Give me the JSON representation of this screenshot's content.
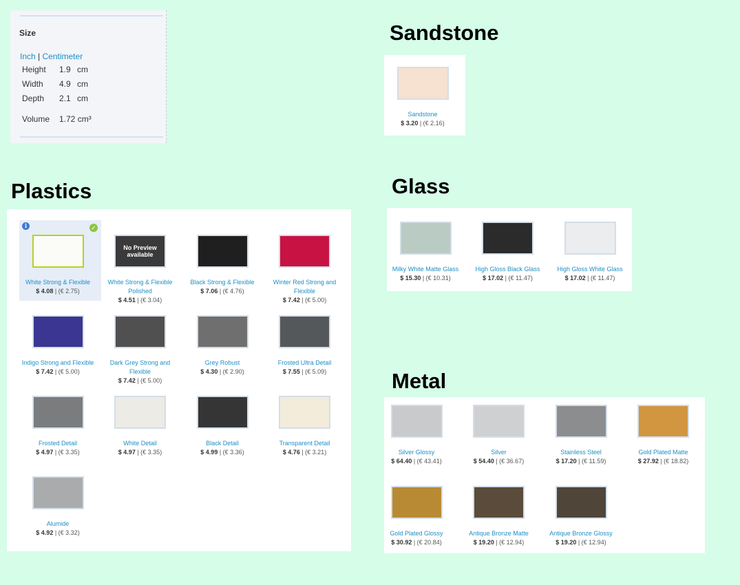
{
  "size_panel": {
    "title": "Size",
    "unit_inch": "Inch",
    "unit_sep": "|",
    "unit_cm": "Centimeter",
    "rows": [
      {
        "label": "Height",
        "value": "1.9",
        "unit": "cm"
      },
      {
        "label": "Width",
        "value": "4.9",
        "unit": "cm"
      },
      {
        "label": "Depth",
        "value": "2.1",
        "unit": "cm"
      }
    ],
    "volume_label": "Volume",
    "volume_value": "1.72 cm³"
  },
  "sections": {
    "sandstone": "Sandstone",
    "plastics": "Plastics",
    "glass": "Glass",
    "metal": "Metal"
  },
  "no_preview_text": "No Preview available",
  "materials": {
    "sandstone": [
      {
        "name": "Sandstone",
        "usd": "$ 3.20",
        "eur": "(€ 2.16)",
        "swatch": "#f7e1d0"
      }
    ],
    "plastics": [
      {
        "name": "White Strong & Flexible",
        "usd": "$ 4.08",
        "eur": "(€ 2.75)",
        "swatch": "#fbfcf7",
        "selected": true
      },
      {
        "name": "White Strong & Flexible Polished",
        "usd": "$ 4.51",
        "eur": "(€ 3.04)",
        "swatch": "#3a3a3a",
        "no_preview": true
      },
      {
        "name": "Black Strong & Flexible",
        "usd": "$ 7.06",
        "eur": "(€ 4.76)",
        "swatch": "#1f1f1f"
      },
      {
        "name": "Winter Red Strong and Flexible",
        "usd": "$ 7.42",
        "eur": "(€ 5.00)",
        "swatch": "#c81244"
      },
      {
        "name": "Indigo Strong and Flexible",
        "usd": "$ 7.42",
        "eur": "(€ 5.00)",
        "swatch": "#3a3691"
      },
      {
        "name": "Dark Grey Strong and Flexible",
        "usd": "$ 7.42",
        "eur": "(€ 5.00)",
        "swatch": "#505050"
      },
      {
        "name": "Grey Robust",
        "usd": "$ 4.30",
        "eur": "(€ 2.90)",
        "swatch": "#6f6f6f"
      },
      {
        "name": "Frosted Ultra Detail",
        "usd": "$ 7.55",
        "eur": "(€ 5.09)",
        "swatch": "#55585a"
      },
      {
        "name": "Frosted Detail",
        "usd": "$ 4.97",
        "eur": "(€ 3.35)",
        "swatch": "#7a7c7d"
      },
      {
        "name": "White Detail",
        "usd": "$ 4.97",
        "eur": "(€ 3.35)",
        "swatch": "#ecebe6"
      },
      {
        "name": "Black Detail",
        "usd": "$ 4.99",
        "eur": "(€ 3.36)",
        "swatch": "#353535"
      },
      {
        "name": "Transparent Detail",
        "usd": "$ 4.76",
        "eur": "(€ 3.21)",
        "swatch": "#f3ecdb"
      },
      {
        "name": "Alumide",
        "usd": "$ 4.92",
        "eur": "(€ 3.32)",
        "swatch": "#a9abad"
      }
    ],
    "glass": [
      {
        "name": "Milky White Matte Glass",
        "usd": "$ 15.30",
        "eur": "(€ 10.31)",
        "swatch": "#b9cbc2"
      },
      {
        "name": "High Gloss Black Glass",
        "usd": "$ 17.02",
        "eur": "(€ 11.47)",
        "swatch": "#2b2b2b"
      },
      {
        "name": "High Gloss White Glass",
        "usd": "$ 17.02",
        "eur": "(€ 11.47)",
        "swatch": "#ebedee"
      }
    ],
    "metal": [
      {
        "name": "Silver Glossy",
        "usd": "$ 64.40",
        "eur": "(€ 43.41)",
        "swatch": "#c9cacb"
      },
      {
        "name": "Silver",
        "usd": "$ 54.40",
        "eur": "(€ 36.67)",
        "swatch": "#cfd0d2"
      },
      {
        "name": "Stainless Steel",
        "usd": "$ 17.20",
        "eur": "(€ 11.59)",
        "swatch": "#8c8d8f"
      },
      {
        "name": "Gold Plated Matte",
        "usd": "$ 27.92",
        "eur": "(€ 18.82)",
        "swatch": "#d1963f"
      },
      {
        "name": "Gold Plated Glossy",
        "usd": "$ 30.92",
        "eur": "(€ 20.84)",
        "swatch": "#b98a34"
      },
      {
        "name": "Antique Bronze Matte",
        "usd": "$ 19.20",
        "eur": "(€ 12.94)",
        "swatch": "#5b4b3a"
      },
      {
        "name": "Antique Bronze Glossy",
        "usd": "$ 19.20",
        "eur": "(€ 12.94)",
        "swatch": "#4f4538"
      }
    ]
  }
}
